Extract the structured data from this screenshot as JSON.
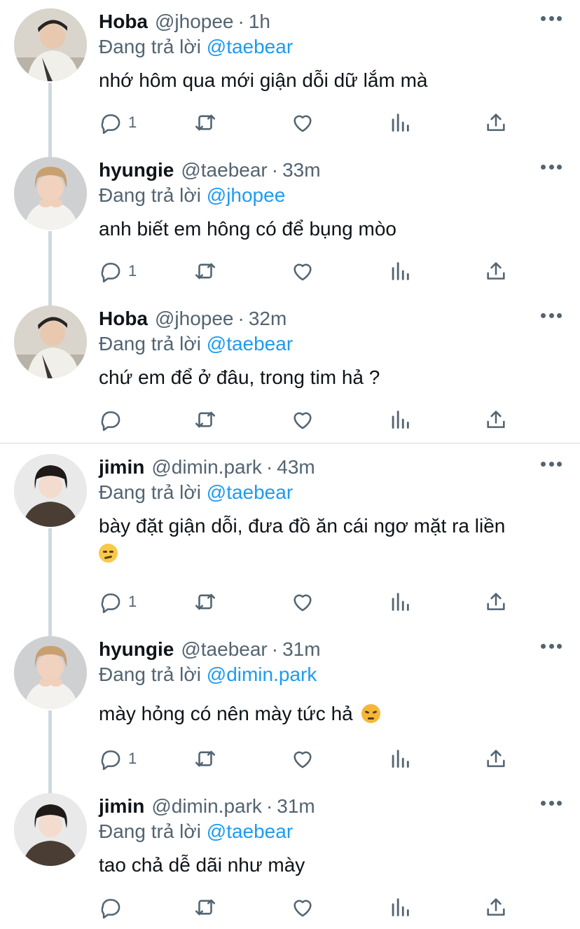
{
  "replying_label": "Đang trả lời",
  "dot": "·",
  "colors": {
    "accent": "#1d9bf0",
    "secondary": "#536471",
    "text": "#0f1419",
    "connector": "#cfd9de"
  },
  "icons": [
    "more-icon",
    "reply-icon",
    "retweet-icon",
    "like-icon",
    "analytics-icon",
    "share-icon"
  ],
  "tweets": [
    {
      "name": "Hoba",
      "handle": "@jhopee",
      "time": "1h",
      "reply_to": "@taebear",
      "text": "nhớ hôm qua mới giận dỗi dữ lắm mà",
      "reply_count": "1"
    },
    {
      "name": "hyungie",
      "handle": "@taebear",
      "time": "33m",
      "reply_to": "@jhopee",
      "text": "anh biết em hông có để bụng mòo",
      "reply_count": "1"
    },
    {
      "name": "Hoba",
      "handle": "@jhopee",
      "time": "32m",
      "reply_to": "@taebear",
      "text": "chứ em để ở đâu, trong tim hả ?",
      "reply_count": ""
    },
    {
      "name": "jimin",
      "handle": "@dimin.park",
      "time": "43m",
      "reply_to": "@taebear",
      "text": "bày đặt giận dỗi, đưa đồ ăn cái ngơ mặt ra liền",
      "emoji": "smirk-emoji",
      "reply_count": "1"
    },
    {
      "name": "hyungie",
      "handle": "@taebear",
      "time": "31m",
      "reply_to": "@dimin.park",
      "text": "mày hỏng có nên mày tức hả",
      "emoji": "angry-emoji",
      "reply_count": "1"
    },
    {
      "name": "jimin",
      "handle": "@dimin.park",
      "time": "31m",
      "reply_to": "@taebear",
      "text": "tao chả dễ dãi như mày",
      "reply_count": ""
    }
  ]
}
